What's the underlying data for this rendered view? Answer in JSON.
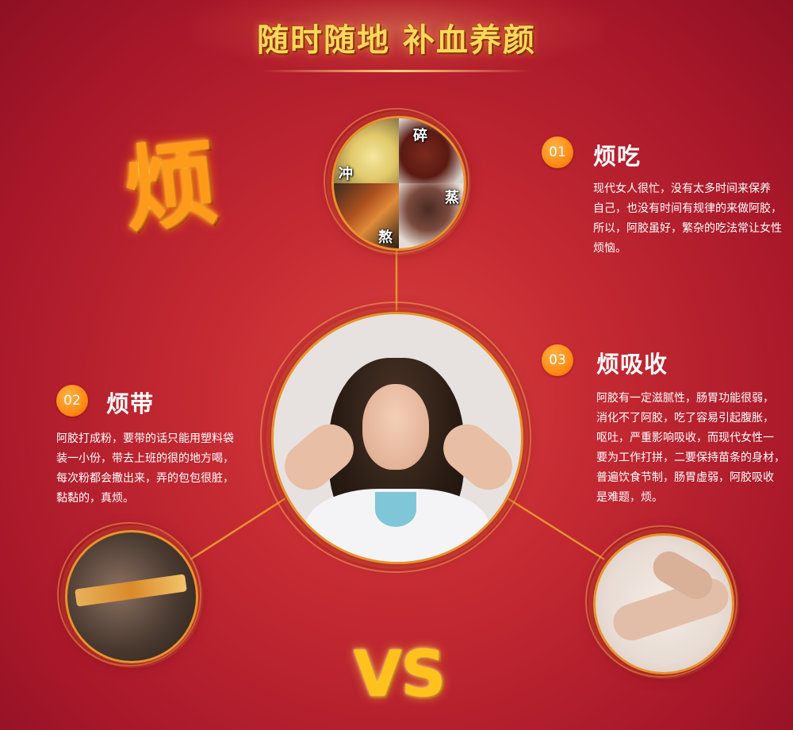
{
  "banner": {
    "title": "随时随地 补血养颜"
  },
  "decor": {
    "fan_char": "烦",
    "vs": "VS"
  },
  "food_labels": [
    "冲",
    "碎",
    "熬",
    "蒸"
  ],
  "sections": [
    {
      "num": "01",
      "title": "烦吃",
      "body": "现代女人很忙，没有太多时间来保养\n自己，也没有时间有规律的来做阿胶，\n所以，阿胶虽好，繁杂的吃法常让女性\n烦恼。"
    },
    {
      "num": "02",
      "title": "烦带",
      "body": "阿胶打成粉，要带的话只能用塑料袋\n装一小份，带去上班的很的地方喝，\n每次粉都会撒出来，弄的包包很脏，\n黏黏的，真烦。"
    },
    {
      "num": "03",
      "title": "烦吸收",
      "body": "阿胶有一定滋腻性，肠胃功能很弱，\n消化不了阿胶，吃了容易引起腹胀，\n呕吐，严重影响吸收，而现代女性一\n要为工作打拼，二要保持苗条的身材，\n普遍饮食节制，肠胃虚弱，阿胶吸收\n是难题，烦。"
    }
  ],
  "colors": {
    "accent": "#ff8a14",
    "ring": "#e9922d",
    "title_gold": "#ffd75a"
  }
}
